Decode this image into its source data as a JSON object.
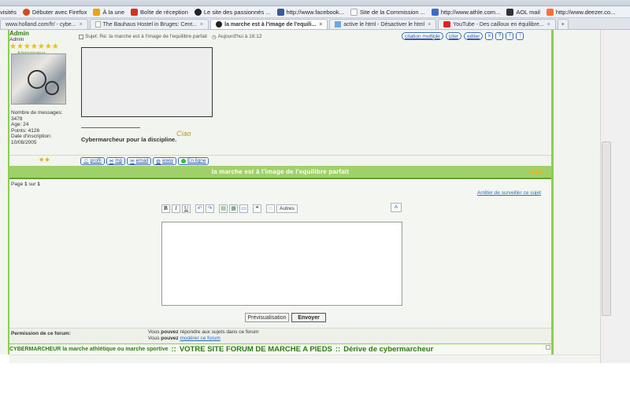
{
  "browser": {
    "bookmarks": [
      {
        "label": "visités",
        "color": "#ffffff"
      },
      {
        "label": "Débuter avec Firefox",
        "color": "#d04a1a"
      },
      {
        "label": "À la une",
        "color": "#e8a317"
      },
      {
        "label": "Boîte de réception",
        "color": "#d93025"
      },
      {
        "label": "Le site des passionnés ...",
        "color": "#222222"
      },
      {
        "label": "http://www.facebook...",
        "color": "#3b5998"
      },
      {
        "label": "Site de la Commission ...",
        "color": "#cccccc"
      },
      {
        "label": "http://www.athle.com...",
        "color": "#3d6cc0"
      },
      {
        "label": "AOL mail",
        "color": "#333333"
      },
      {
        "label": "http://www.deezer.co...",
        "color": "#ff6f3c"
      }
    ],
    "tabs": [
      {
        "label": "www.holland.com/fr/ - cybe...",
        "active": false
      },
      {
        "label": "The Bauhaus Hostel in Bruges: Cent...",
        "active": false
      },
      {
        "label": "la marche est à l'image de l'equili...",
        "active": true
      },
      {
        "label": "active le html - Désactiver le html",
        "active": false
      },
      {
        "label": "YouTube - Des cailloux en équilibre...",
        "active": false
      }
    ]
  },
  "post": {
    "author": "Admin",
    "author_sub": "Admin",
    "stars": "★★★★★★★",
    "rank": "Administrateur",
    "stats": {
      "messages_label": "Nombre de messages:",
      "messages": "3478",
      "age": "Age: 24",
      "points": "Points: 4126",
      "joined_label": "Date d'inscription:",
      "joined": "10/08/2005"
    },
    "subject": "Sujet: Re: la marche est à l'image de l'equilibre parfait",
    "time": "Aujourd'hui à 18:12",
    "buttons": {
      "multi_quote": "citation multiple",
      "quote": "citer",
      "edit": "editer",
      "delete": "x",
      "ip": "?",
      "warn": "!",
      "report": "!"
    },
    "signature": "Cybermarcheur pour la discipline.",
    "ciao": "Ciao",
    "actions": {
      "profile": "profil",
      "mp": "mp",
      "email": "email",
      "www": "www",
      "online": "En ligne"
    },
    "arrows": "◆ ◆"
  },
  "topic": {
    "title": "la marche est à l'image de l'equilibre parfait",
    "nav_arrows": "◆◆◆"
  },
  "page": {
    "label_prefix": "Page",
    "current": "1",
    "separator": "sur",
    "total": "1",
    "stop_watching": "Arrêter de surveiller ce sujet"
  },
  "editor": {
    "toolbar": [
      "B",
      "I",
      "U",
      "↶",
      "↷",
      "▤",
      "▦",
      "▭",
      "❝",
      "☺"
    ],
    "more": "Autres",
    "toggle": "A",
    "preview": "Prévisualisation",
    "send": "Envoyer",
    "content": ""
  },
  "permissions": {
    "label": "Permission de ce forum:",
    "line1_a": "Vous",
    "line1_b": "pouvez",
    "line1_c": "répondre aux sujets dans ce forum",
    "line2_a": "Vous",
    "line2_b": "pouvez",
    "line2_link": "modérer ce forum"
  },
  "footer": {
    "part1": "CYBERMARCHEUR la marche athlétique ou marche sportive",
    "sep": "::",
    "part2": "VOTRE SITE FORUM DE MARCHE A PIEDS",
    "sep2": "::",
    "part3": "Dérive de cybermarcheur"
  },
  "colors": {
    "accent_green": "#8fce4a",
    "title_bar": "#9fd06a",
    "link_blue": "#2a6cb5"
  }
}
